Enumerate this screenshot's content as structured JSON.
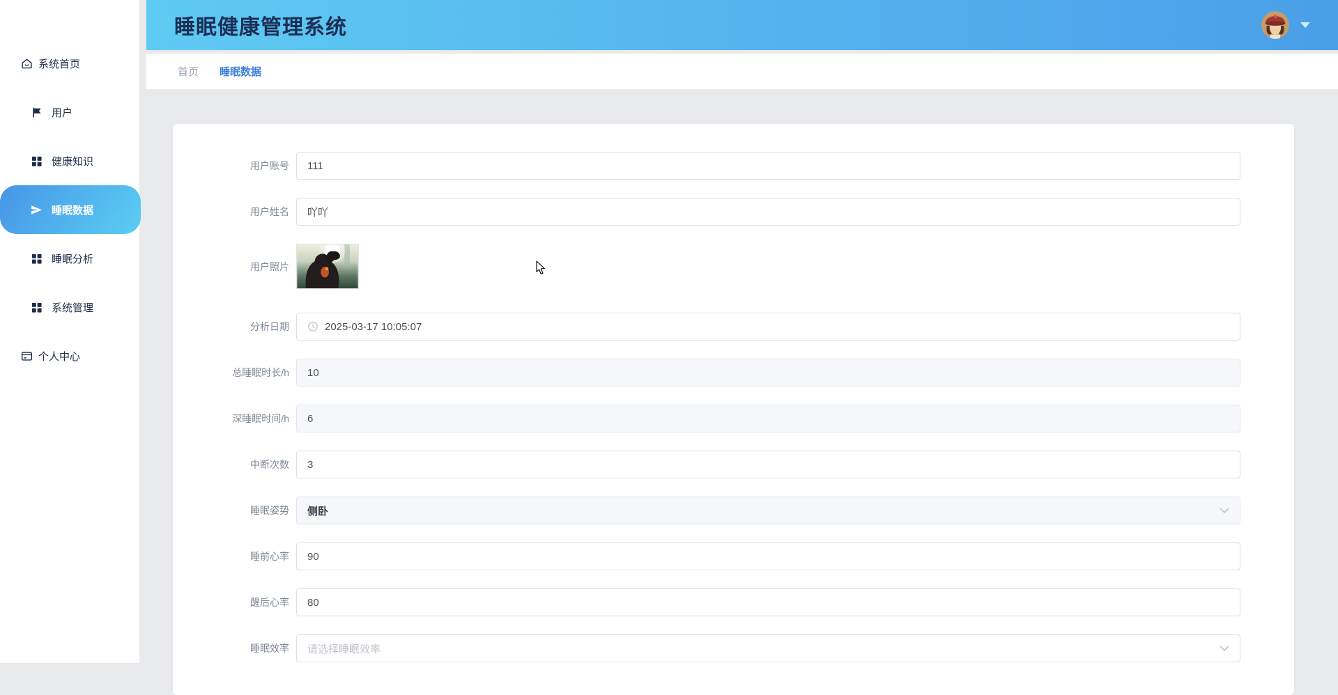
{
  "app": {
    "title": "睡眠健康管理系统"
  },
  "sidebar": {
    "items": [
      {
        "label": "系统首页",
        "icon": "home-icon",
        "active": false
      },
      {
        "label": "用户",
        "icon": "flag-icon",
        "active": false
      },
      {
        "label": "健康知识",
        "icon": "grid-icon",
        "active": false
      },
      {
        "label": "睡眠数据",
        "icon": "paper-plane-icon",
        "active": true
      },
      {
        "label": "睡眠分析",
        "icon": "grid-icon",
        "active": false
      },
      {
        "label": "系统管理",
        "icon": "grid-icon",
        "active": false
      },
      {
        "label": "个人中心",
        "icon": "id-card-icon",
        "active": false
      }
    ]
  },
  "breadcrumb": {
    "items": [
      {
        "label": "首页"
      },
      {
        "label": "睡眠数据"
      }
    ]
  },
  "form": {
    "fields": [
      {
        "label": "用户账号",
        "value": "111",
        "type": "text"
      },
      {
        "label": "用户姓名",
        "value": "吖吖",
        "type": "text"
      },
      {
        "label": "用户照片",
        "type": "image",
        "image_alt": "user-photo-thumbnail"
      },
      {
        "label": "分析日期",
        "value": "2025-03-17 10:05:07",
        "type": "datetime",
        "icon": "clock-icon"
      },
      {
        "label": "总睡眠时长/h",
        "value": "10",
        "type": "text",
        "disabled": true
      },
      {
        "label": "深睡眠时间/h",
        "value": "6",
        "type": "text",
        "disabled": true
      },
      {
        "label": "中断次数",
        "value": "3",
        "type": "text"
      },
      {
        "label": "睡眠姿势",
        "value": "侧卧",
        "type": "select",
        "disabled": true
      },
      {
        "label": "睡前心率",
        "value": "90",
        "type": "text"
      },
      {
        "label": "醒后心率",
        "value": "80",
        "type": "text"
      },
      {
        "label": "睡眠效率",
        "value": "",
        "placeholder": "请选择睡眠效率",
        "type": "select"
      }
    ]
  },
  "colors": {
    "header_gradient_start": "#5fcaf2",
    "header_gradient_end": "#4a9fe8",
    "active_item_gradient_start": "#4795e7",
    "active_item_gradient_end": "#58c9f2",
    "breadcrumb_active": "#3d7fd9",
    "page_bg": "#e9eaec",
    "title_text": "#1b2e55"
  }
}
